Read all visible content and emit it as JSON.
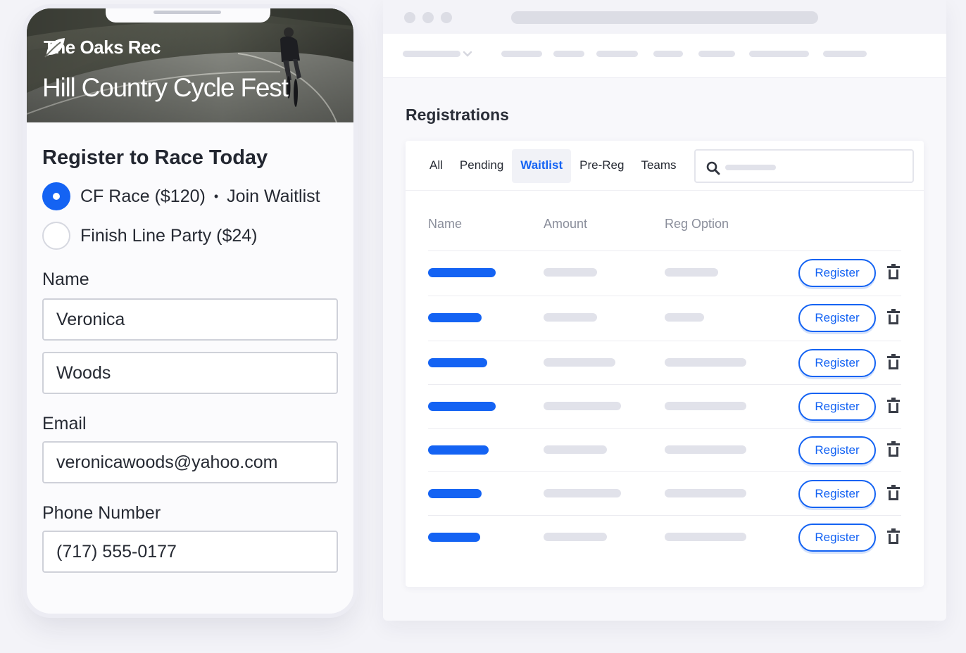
{
  "phone": {
    "brand_name": "The Oaks Rec",
    "event_title": "Hill Country Cycle Fest",
    "form_heading": "Register to Race Today",
    "options": [
      {
        "label": "CF Race ($120)",
        "extra": "Join Waitlist",
        "separator": "•",
        "selected": true
      },
      {
        "label": "Finish Line Party ($24)",
        "selected": false
      }
    ],
    "name_label": "Name",
    "first_name_value": "Veronica",
    "last_name_value": "Woods",
    "email_label": "Email",
    "email_value": "veronicawoods@yahoo.com",
    "phone_label": "Phone Number",
    "phone_value": "(717) 555-0177"
  },
  "registrations": {
    "title": "Registrations",
    "tabs": [
      {
        "label": "All",
        "active": false
      },
      {
        "label": "Pending",
        "active": false
      },
      {
        "label": "Waitlist",
        "active": true
      },
      {
        "label": "Pre-Reg",
        "active": false
      },
      {
        "label": "Teams",
        "active": false
      }
    ],
    "columns": {
      "name": "Name",
      "amount": "Amount",
      "reg_option": "Reg Option"
    },
    "rows": [
      {
        "register_label": "Register"
      },
      {
        "register_label": "Register"
      },
      {
        "register_label": "Register"
      },
      {
        "register_label": "Register"
      },
      {
        "register_label": "Register"
      },
      {
        "register_label": "Register"
      },
      {
        "register_label": "Register"
      }
    ]
  },
  "icons": {
    "brand": "leaf-icon",
    "search": "search-icon",
    "delete": "trash-icon",
    "dropdown": "chevron-down-icon"
  },
  "colors": {
    "accent": "#1463f3",
    "placeholder": "#e1e2ea",
    "background": "#f3f3f8"
  }
}
